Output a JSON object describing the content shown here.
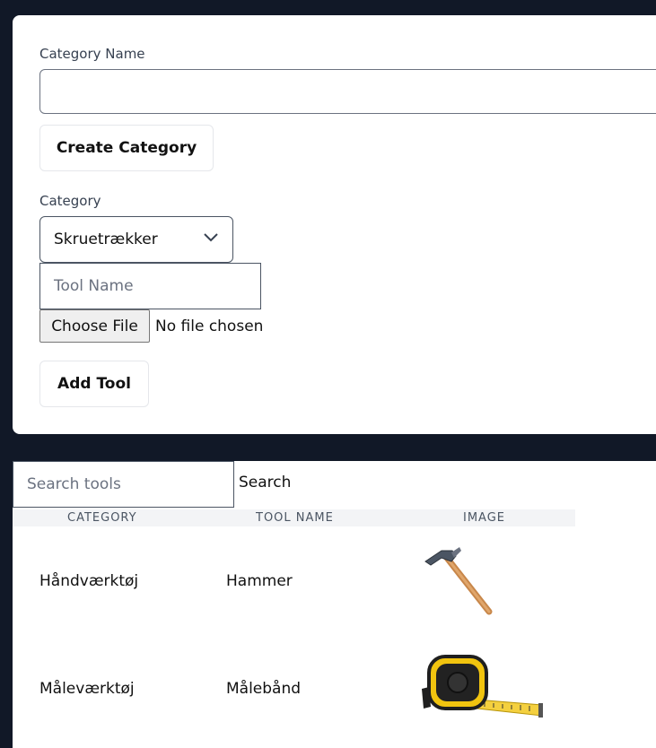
{
  "category_form": {
    "name_label": "Category Name",
    "name_value": "",
    "create_button": "Create Category"
  },
  "tool_form": {
    "category_label": "Category",
    "category_selected": "Skruetrækker",
    "tool_name_placeholder": "Tool Name",
    "file_button": "Choose File",
    "file_status": "No file chosen",
    "add_button": "Add Tool"
  },
  "search": {
    "placeholder": "Search tools",
    "button": "Search"
  },
  "table": {
    "columns": [
      "CATEGORY",
      "TOOL NAME",
      "IMAGE"
    ],
    "rows": [
      {
        "category": "Håndværktøj",
        "tool_name": "Hammer",
        "image": "hammer-image"
      },
      {
        "category": "Måleværktøj",
        "tool_name": "Målebånd",
        "image": "tape-measure-image"
      }
    ]
  },
  "colors": {
    "page_background": "#111827",
    "card_background": "#ffffff",
    "header_background": "#f3f4f6"
  }
}
